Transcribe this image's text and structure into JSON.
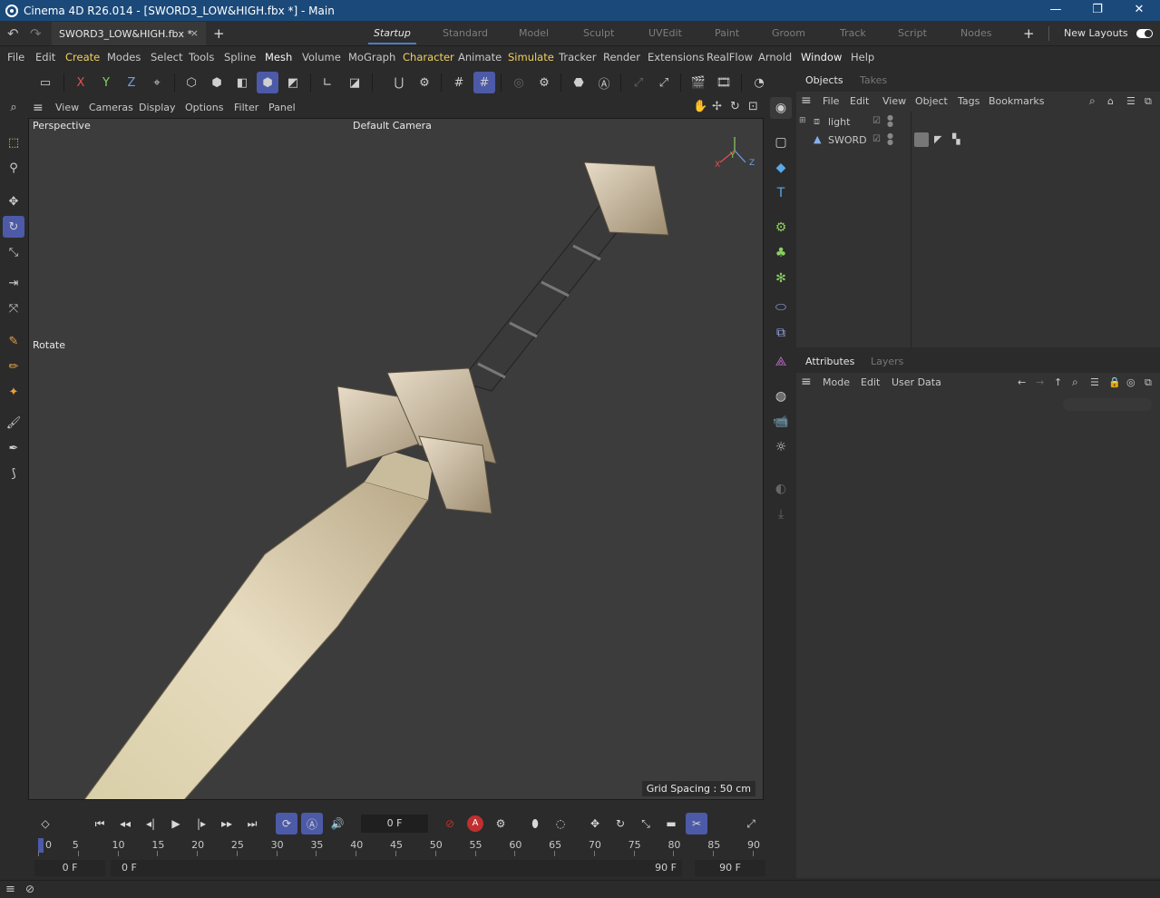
{
  "window": {
    "title": "Cinema 4D R26.014 - [SWORD3_LOW&HIGH.fbx *] - Main",
    "minimize": "—",
    "restore": "❐",
    "close": "✕"
  },
  "doc_tab": {
    "label": "SWORD3_LOW&HIGH.fbx *",
    "close": "×"
  },
  "layouts": {
    "tabs": [
      "Startup",
      "Standard",
      "Model",
      "Sculpt",
      "UVEdit",
      "Paint",
      "Groom",
      "Track",
      "Script",
      "Nodes"
    ],
    "active": "Startup",
    "new_layouts": "New Layouts"
  },
  "menu": [
    "File",
    "Edit",
    "Create",
    "Modes",
    "Select",
    "Tools",
    "Spline",
    "Mesh",
    "Volume",
    "MoGraph",
    "Character",
    "Animate",
    "Simulate",
    "Tracker",
    "Render",
    "Extensions",
    "RealFlow",
    "Arnold",
    "Window",
    "Help"
  ],
  "toolbar": {
    "x": "X",
    "y": "Y",
    "z": "Z"
  },
  "viewport_menu": [
    "View",
    "Cameras",
    "Display",
    "Options",
    "Filter",
    "Panel"
  ],
  "viewport": {
    "projection": "Perspective",
    "camera": "Default Camera",
    "tool_label": "Rotate",
    "grid_spacing": "Grid Spacing : 50 cm",
    "axis": {
      "x": "X",
      "y": "Y",
      "z": "Z"
    }
  },
  "objects_panel": {
    "tabs": [
      "Objects",
      "Takes"
    ],
    "menu": [
      "File",
      "Edit",
      "View",
      "Object",
      "Tags",
      "Bookmarks"
    ],
    "items": [
      {
        "name": "light"
      },
      {
        "name": "SWORD"
      }
    ]
  },
  "attributes_panel": {
    "tabs": [
      "Attributes",
      "Layers"
    ],
    "menu": [
      "Mode",
      "Edit",
      "User Data"
    ]
  },
  "timeline": {
    "current_frame": "0 F",
    "ticks": [
      "0",
      "5",
      "10",
      "15",
      "20",
      "25",
      "30",
      "35",
      "40",
      "45",
      "50",
      "55",
      "60",
      "65",
      "70",
      "75",
      "80",
      "85",
      "90"
    ],
    "start": "0 F",
    "range_start": "0 F",
    "range_end": "90 F",
    "end": "90 F"
  }
}
